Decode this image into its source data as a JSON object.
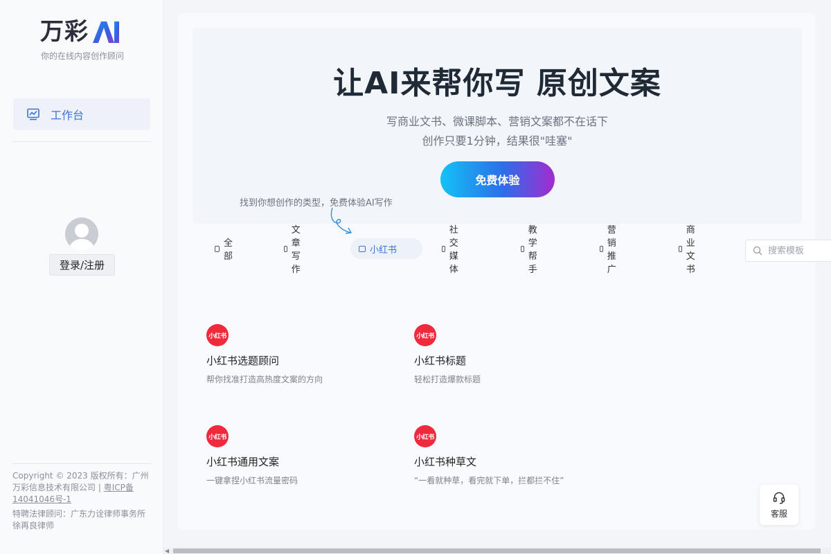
{
  "brand": {
    "name": "万彩",
    "tagline": "你的在线内容创作顾问"
  },
  "sidebar": {
    "nav_label": "工作台",
    "login_label": "登录/注册",
    "copyright_prefix": "Copyright © 2023 版权所有：广州万彩信息技术有限公司 | ",
    "icp": "粤ICP备14041046号-1",
    "lawyer": "特聘法律顾问：广东力诠律师事务所徐再良律师"
  },
  "hero": {
    "title": "让AI来帮你写 原创文案",
    "sub1": "写商业文书、微课脚本、营销文案都不在话下",
    "sub2": "创作只要1分钟，结果很\"哇塞\"",
    "cta": "免费体验",
    "hint": "找到你想创作的类型，免费体验AI写作"
  },
  "tabs": [
    {
      "label": "全部"
    },
    {
      "label": "文章写作"
    },
    {
      "label": "小红书"
    },
    {
      "label": "社交媒体"
    },
    {
      "label": "教学帮手"
    },
    {
      "label": "营销推广"
    },
    {
      "label": "商业文书"
    }
  ],
  "active_tab": "小红书",
  "search": {
    "placeholder": "搜索模板"
  },
  "templates": [
    {
      "icon": "小红书",
      "title": "小红书选题顾问",
      "desc": "帮你找准打造高热度文案的方向"
    },
    {
      "icon": "小红书",
      "title": "小红书标题",
      "desc": "轻松打造爆款标题"
    },
    {
      "icon": "小红书",
      "title": "小红书通用文案",
      "desc": "一键拿捏小红书流量密码"
    },
    {
      "icon": "小红书",
      "title": "小红书种草文",
      "desc": "“一看就种草，看完就下单，拦都拦不住”"
    }
  ],
  "service_label": "客服",
  "colors": {
    "accent": "#3b73d6",
    "brand_red": "#f0293d"
  }
}
